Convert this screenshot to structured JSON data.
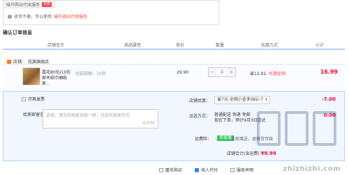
{
  "promo": {
    "tab_label": "喵鸟购站代收服务",
    "badge": "免费",
    "line_prefix": "收货不便，可以使用",
    "line_link": "喵鸟驿站代收服务"
  },
  "section_title": "确认订单信息",
  "columns": [
    "店铺宝贝",
    "商品属性",
    "单价",
    "数量",
    "优惠方式",
    "小计"
  ],
  "store": {
    "label": "店铺：",
    "name": "花旗旗舰店"
  },
  "product": {
    "title": "露花80包/10包原木纸巾抽纸家...",
    "prop": "包装规格：10包",
    "price": "29.90",
    "qty": "1",
    "discount": "省12.91:",
    "discount_tag": "优惠促销",
    "subtotal": "16.99"
  },
  "options": {
    "invoice_label": "开具发票",
    "message_label": "给卖家留言：",
    "message_placeholder": "选填，请先和商家协商一致，付款后商家可见",
    "message_count": "0/200",
    "coupon_label": "店铺优惠：",
    "coupon_value": "省7元:全网小金多SKU-7",
    "coupon_amount": "-7.00",
    "ship_label": "运送方式：",
    "ship_line1": "普通配送 快递 免邮",
    "ship_line2": "现在下单，预计9月3日送达",
    "ship_amount": "0.00",
    "ins_label": "运费险：",
    "ins_badge": "卖家赠",
    "ins_text": "卖家赠送，退换货可赔",
    "total_label": "店铺合计(含运费)",
    "total_value": "¥9.99"
  },
  "footer": {
    "opt1": "匿名购买",
    "opt2": "找人代付",
    "opt3": "服务声明"
  },
  "watermark": "zhizhizhi.com",
  "colors": {
    "accent": "#ff0036",
    "border": "#b2d1ff",
    "ins": "#37c35c"
  }
}
